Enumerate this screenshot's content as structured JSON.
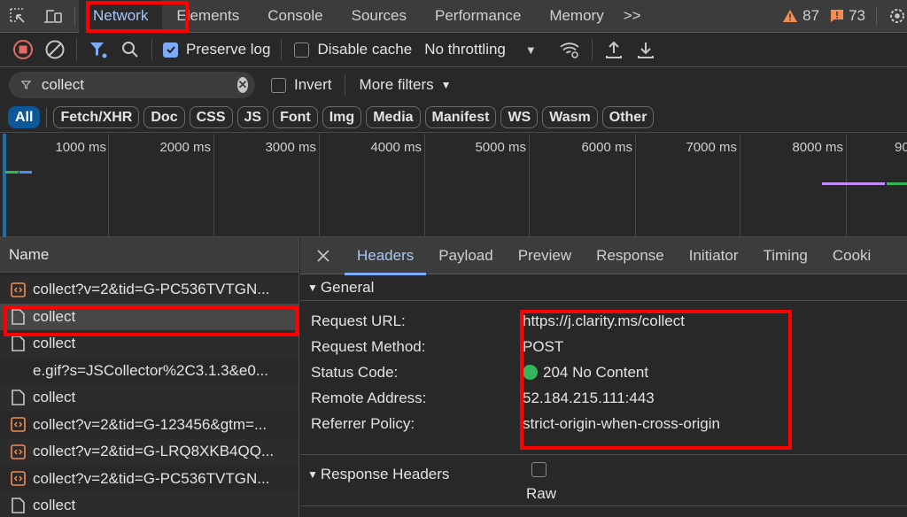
{
  "main_tabs": [
    {
      "label": "Network",
      "active": true
    },
    {
      "label": "Elements"
    },
    {
      "label": "Console"
    },
    {
      "label": "Sources"
    },
    {
      "label": "Performance"
    },
    {
      "label": "Memory"
    }
  ],
  "more_tabs_label": ">>",
  "warnings_count": "87",
  "issues_count": "73",
  "toolbar": {
    "preserve_log_label": "Preserve log",
    "preserve_log_checked": true,
    "disable_cache_label": "Disable cache",
    "disable_cache_checked": false,
    "throttling_value": "No throttling"
  },
  "filter": {
    "value": "collect",
    "invert_label": "Invert",
    "more_filters_label": "More filters"
  },
  "type_filters": [
    "All",
    "Fetch/XHR",
    "Doc",
    "CSS",
    "JS",
    "Font",
    "Img",
    "Media",
    "Manifest",
    "WS",
    "Wasm",
    "Other"
  ],
  "timeline": {
    "ticks": [
      "1000 ms",
      "2000 ms",
      "3000 ms",
      "4000 ms",
      "5000 ms",
      "6000 ms",
      "7000 ms",
      "8000 ms",
      "90"
    ],
    "colors": {
      "green": "#34b55a",
      "blue": "#4d8ff0",
      "purple": "#c58af9"
    }
  },
  "requests": {
    "column_header": "Name",
    "rows": [
      {
        "name": "collect?v=2&tid=G-PC536TVTGN...",
        "type": "script"
      },
      {
        "name": "collect",
        "type": "document",
        "selected": true
      },
      {
        "name": "collect",
        "type": "document"
      },
      {
        "name": "e.gif?s=JSCollector%2C3.1.3&e0...",
        "type": "none"
      },
      {
        "name": "collect",
        "type": "document"
      },
      {
        "name": "collect?v=2&tid=G-123456&gtm=...",
        "type": "script"
      },
      {
        "name": "collect?v=2&tid=G-LRQ8XKB4QQ...",
        "type": "script"
      },
      {
        "name": "collect?v=2&tid=G-PC536TVTGN...",
        "type": "script"
      },
      {
        "name": "collect",
        "type": "document"
      }
    ]
  },
  "detail_tabs": [
    "Headers",
    "Payload",
    "Preview",
    "Response",
    "Initiator",
    "Timing",
    "Cooki"
  ],
  "general": {
    "title": "General",
    "fields": [
      {
        "key": "Request URL:",
        "value": "https://j.clarity.ms/collect"
      },
      {
        "key": "Request Method:",
        "value": "POST"
      },
      {
        "key": "Status Code:",
        "value": "204 No Content",
        "status_color": "#34b55a"
      },
      {
        "key": "Remote Address:",
        "value": "52.184.215.111:443"
      },
      {
        "key": "Referrer Policy:",
        "value": "strict-origin-when-cross-origin"
      }
    ]
  },
  "response_headers": {
    "title": "Response Headers",
    "raw_label": "Raw",
    "raw_checked": false
  },
  "highlight_color": "#ff0000"
}
